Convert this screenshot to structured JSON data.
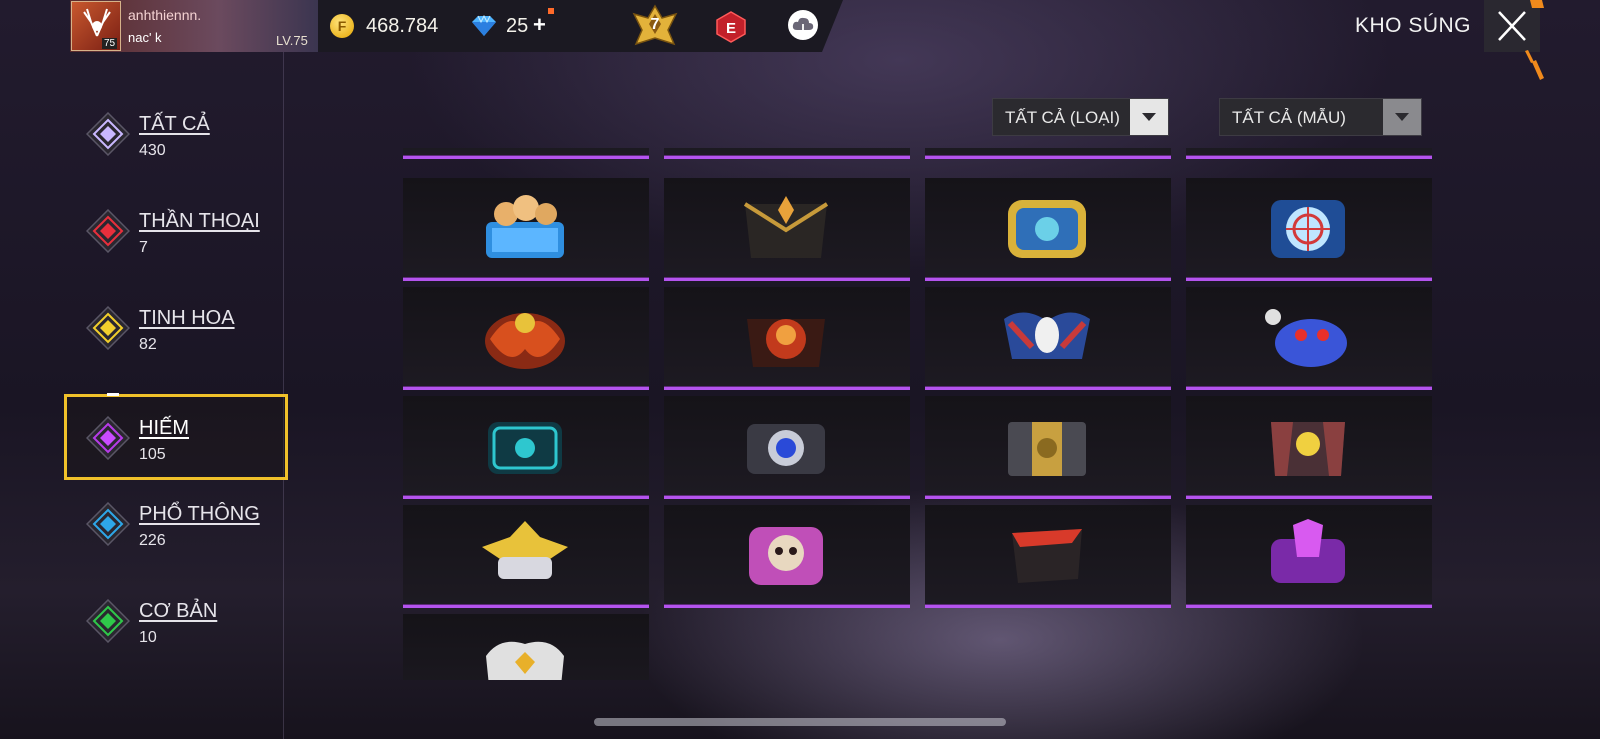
{
  "player": {
    "name": "anhthiennn.",
    "guild": "nac'    k",
    "avatar_level": "75",
    "level": "LV.75"
  },
  "currency": {
    "coin_icon": "F",
    "coins": "468.784",
    "diamonds": "25",
    "add_label": "+"
  },
  "badges": {
    "rank_number": "7",
    "elite_label": "E"
  },
  "page_title": "KHO SÚNG",
  "categories": [
    {
      "name": "TẤT CẢ",
      "count": "430",
      "color": "#c9b8ff"
    },
    {
      "name": "THẦN THOẠI",
      "count": "7",
      "color": "#e82f3c"
    },
    {
      "name": "TINH HOA",
      "count": "82",
      "color": "#f2cf2c"
    },
    {
      "name": "HIẾM",
      "count": "105",
      "color": "#b63be8"
    },
    {
      "name": "PHỔ THÔNG",
      "count": "226",
      "color": "#2ea7e8"
    },
    {
      "name": "CƠ BẢN",
      "count": "10",
      "color": "#2fc84a"
    }
  ],
  "active_category": "HIẾM",
  "filters": {
    "type_label": "TẤT CẢ (LOẠI)",
    "style_label": "TẤT CẢ (MẪU)"
  },
  "items": [
    {
      "icon": "shiba-crate-icon",
      "color": "#2f8fe0"
    },
    {
      "icon": "black-gold-crate-icon",
      "color": "#c79a3a"
    },
    {
      "icon": "gold-blue-crate-icon",
      "color": "#d9b23a"
    },
    {
      "icon": "crosshair-crate-icon",
      "color": "#4aa8e8"
    },
    {
      "icon": "dragon-crate-icon",
      "color": "#d8501e"
    },
    {
      "icon": "flame-skull-crate-icon",
      "color": "#c23a1c"
    },
    {
      "icon": "eagle-skull-crate-icon",
      "color": "#c83a3a"
    },
    {
      "icon": "blue-monster-crate-icon",
      "color": "#3a55d8"
    },
    {
      "icon": "cyan-tech-crate-icon",
      "color": "#2ec7cf"
    },
    {
      "icon": "lens-crate-icon",
      "color": "#9aa0b0"
    },
    {
      "icon": "vault-crate-icon",
      "color": "#c8a040"
    },
    {
      "icon": "sunflower-crate-icon",
      "color": "#8a4040"
    },
    {
      "icon": "winged-gold-crate-icon",
      "color": "#e8c23a"
    },
    {
      "icon": "pink-skull-crate-icon",
      "color": "#c04fb8"
    },
    {
      "icon": "red-black-crate-icon",
      "color": "#d83a2a"
    },
    {
      "icon": "purple-crystal-crate-icon",
      "color": "#b03ad8"
    },
    {
      "icon": "white-gold-crate-icon",
      "color": "#e0e0e0"
    }
  ]
}
